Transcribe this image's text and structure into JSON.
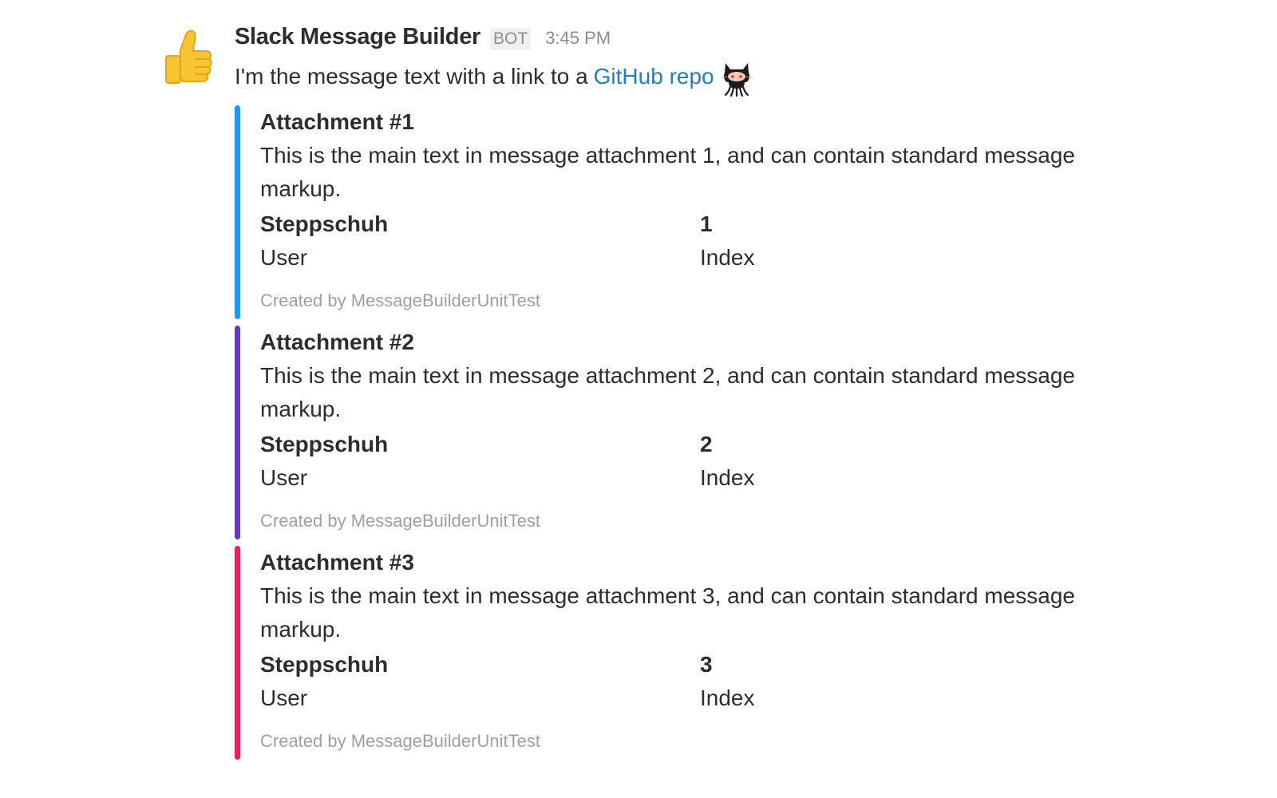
{
  "message": {
    "sender": "Slack Message Builder",
    "badge": "BOT",
    "timestamp": "3:45 PM",
    "avatar_icon": "thumbs-up-icon",
    "text_prefix": "I'm the message text with a link to a",
    "link_text": "GitHub repo",
    "link_color": "#1f7fbf",
    "trailing_icon": "octocat-icon"
  },
  "attachments": [
    {
      "color": "#2196f3",
      "title": "Attachment #1",
      "text": "This is the main text in message attachment 1, and can contain standard message markup.",
      "fields": [
        {
          "title": "Steppschuh",
          "value": "User"
        },
        {
          "title": "1",
          "value": "Index"
        }
      ],
      "footer": "Created by MessageBuilderUnitTest"
    },
    {
      "color": "#673ab7",
      "title": "Attachment #2",
      "text": "This is the main text in message attachment 2, and can contain standard message markup.",
      "fields": [
        {
          "title": "Steppschuh",
          "value": "User"
        },
        {
          "title": "2",
          "value": "Index"
        }
      ],
      "footer": "Created by MessageBuilderUnitTest"
    },
    {
      "color": "#e91e63",
      "title": "Attachment #3",
      "text": "This is the main text in message attachment 3, and can contain standard message markup.",
      "fields": [
        {
          "title": "Steppschuh",
          "value": "User"
        },
        {
          "title": "3",
          "value": "Index"
        }
      ],
      "footer": "Created by MessageBuilderUnitTest"
    }
  ]
}
